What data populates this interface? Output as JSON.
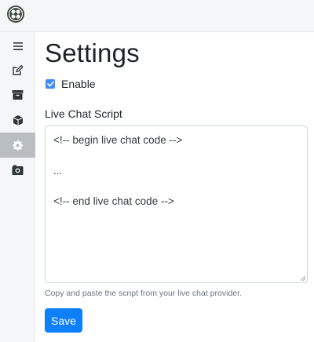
{
  "header": {
    "logo_icon": "app-logo-icon"
  },
  "sidebar": {
    "items": [
      {
        "icon": "menu-icon",
        "active": false
      },
      {
        "icon": "edit-icon",
        "active": false
      },
      {
        "icon": "archive-icon",
        "active": false
      },
      {
        "icon": "box-icon",
        "active": false
      },
      {
        "icon": "gear-icon",
        "active": true
      },
      {
        "icon": "camera-icon",
        "active": false
      }
    ]
  },
  "page": {
    "title": "Settings",
    "enable_label": "Enable",
    "enable_checked": true,
    "script_label": "Live Chat Script",
    "script_lines": [
      "<!-- begin live chat code -->",
      "",
      "...",
      "",
      "<!-- end live chat code -->"
    ],
    "help_text": "Copy and paste the script from your live chat provider.",
    "save_label": "Save"
  },
  "colors": {
    "accent": "#0d7ff9",
    "checkbox": "#3d8ef8",
    "sidebar_bg": "#f5f6f7",
    "sidebar_active": "#b9bec3"
  }
}
